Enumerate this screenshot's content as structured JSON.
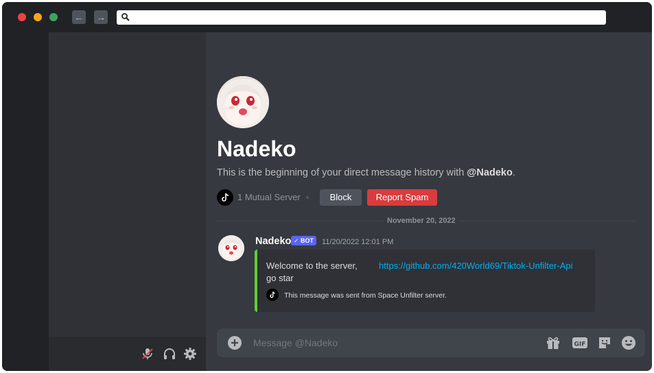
{
  "browser": {
    "back_glyph": "←",
    "forward_glyph": "→",
    "url_icon": "search-icon"
  },
  "dm": {
    "name": "Nadeko",
    "intro_prefix": "This is the beginning of your direct message history with ",
    "intro_mention": "@Nadeko",
    "intro_suffix": ".",
    "mutual_servers": "1 Mutual Server",
    "block_label": "Block",
    "report_label": "Report Spam"
  },
  "divider": {
    "date": "November 20, 2022"
  },
  "message": {
    "author": "Nadeko",
    "bot_tag": "✓ BOT",
    "timestamp": "11/20/2022 12:01 PM",
    "embed": {
      "text": "Welcome to the server,",
      "link": "https://github.com/420World69/Tiktok-Unfilter-Api",
      "text2": "go star",
      "footer": "This message was sent from Space Unfilter server.",
      "accent_color": "#5fce36"
    }
  },
  "composer": {
    "placeholder": "Message @Nadeko"
  },
  "icons": {
    "userbar": [
      "mic-muted-icon",
      "headphones-icon",
      "gear-icon"
    ],
    "composer": [
      "gift-icon",
      "gif-icon",
      "sticker-icon",
      "emoji-icon"
    ]
  },
  "colors": {
    "danger": "#d83c3e",
    "blurple": "#5865f2",
    "link": "#00aff4"
  }
}
